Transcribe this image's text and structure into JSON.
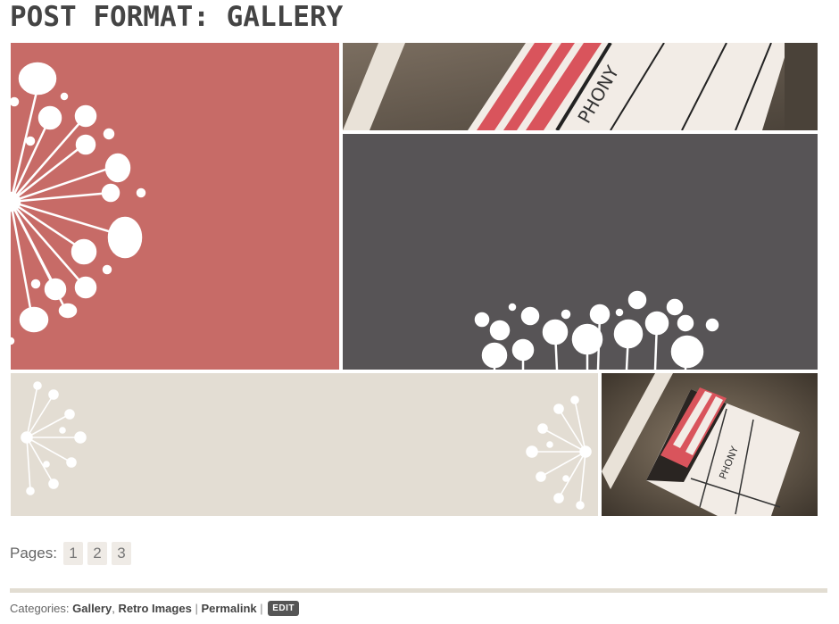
{
  "post": {
    "title": "POST FORMAT: GALLERY"
  },
  "gallery": {
    "tiles": [
      {
        "subject": "white-dandelion-on-red"
      },
      {
        "subject": "film-clapperboard-phony"
      },
      {
        "subject": "white-dandelion-flowers-on-gray"
      },
      {
        "subject": "white-dandelions-on-paper-texture"
      },
      {
        "subject": "film-clapperboard-phony"
      }
    ],
    "colors": {
      "red": "#c76b67",
      "gray": "#575456",
      "paper": "#e3ddd3",
      "stripe": "#d9545c",
      "slate": "#f3ede6"
    }
  },
  "pagination": {
    "label": "Pages:",
    "pages": [
      "1",
      "2",
      "3"
    ]
  },
  "meta": {
    "categories_label": "Categories:",
    "category_1": "Gallery",
    "comma": ",",
    "category_2": "Retro Images",
    "separator": "|",
    "permalink": "Permalink",
    "edit": "EDIT"
  }
}
